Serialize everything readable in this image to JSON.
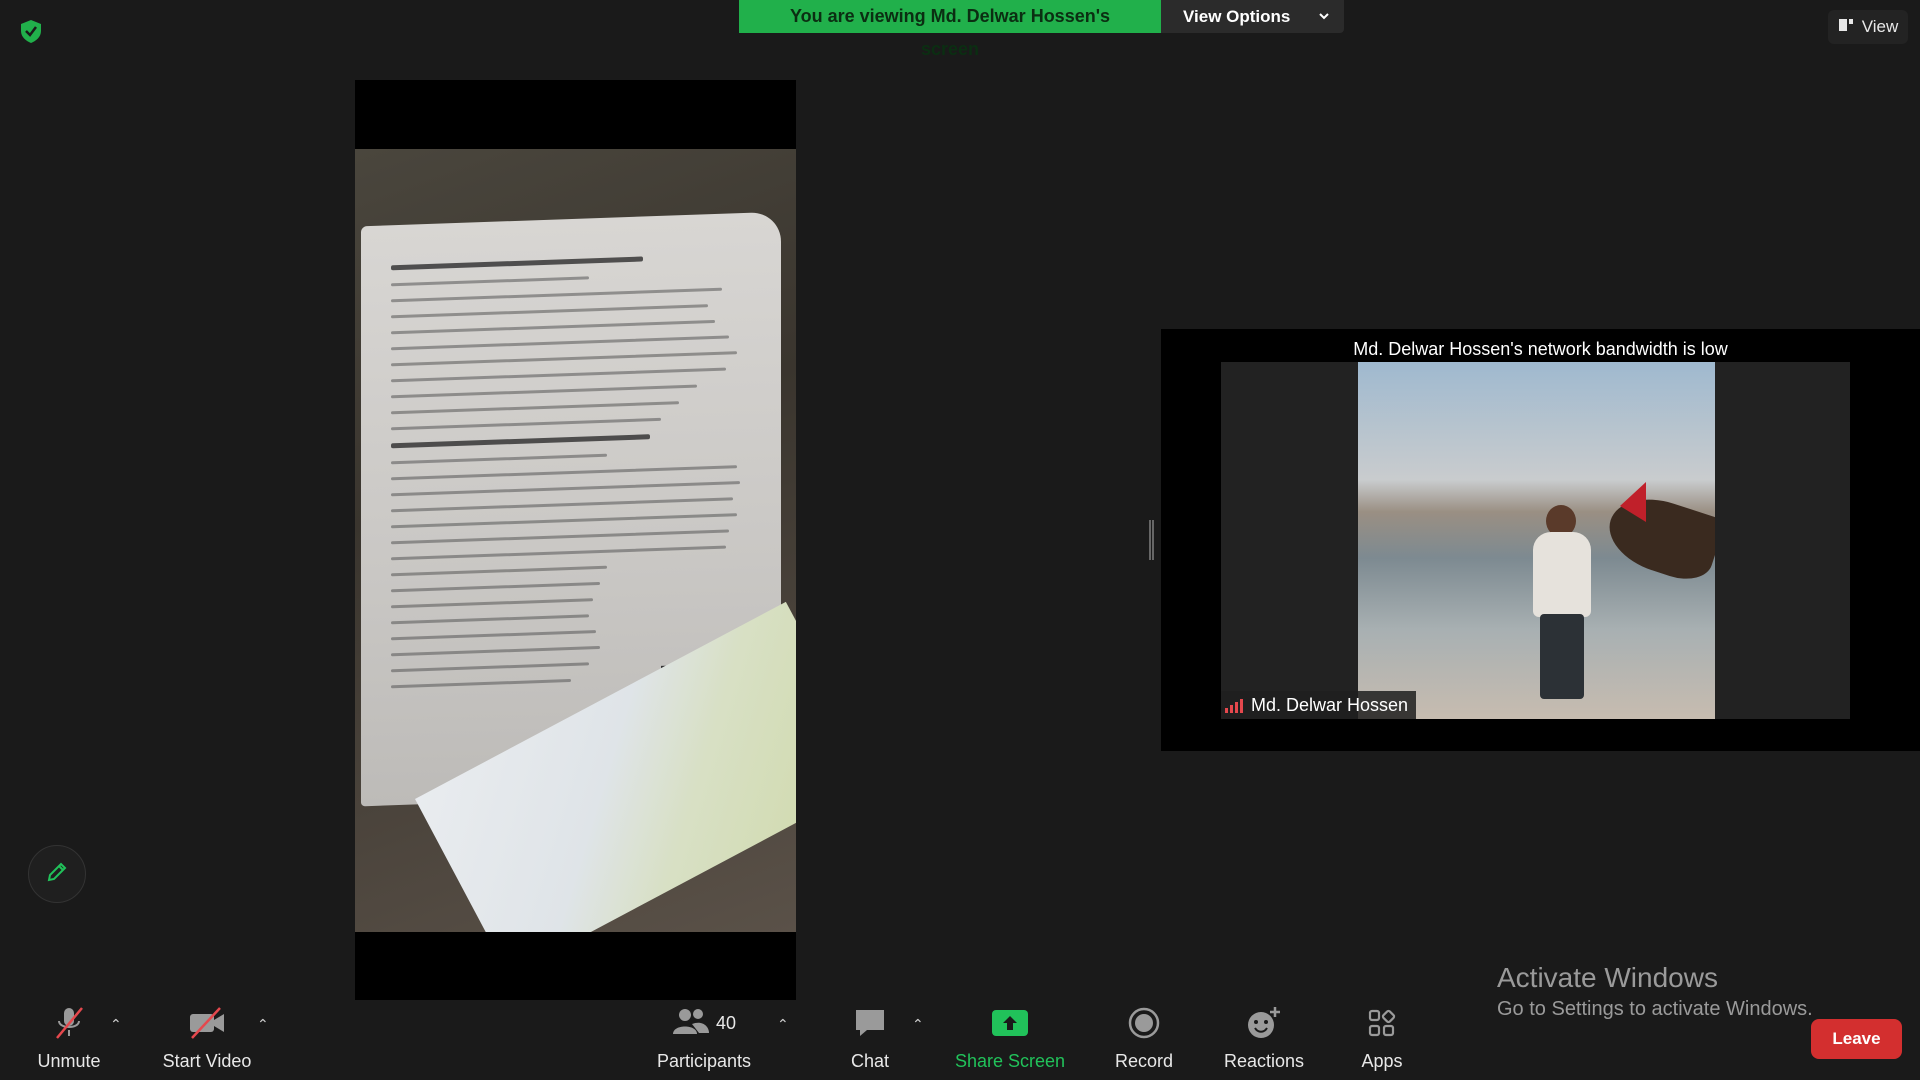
{
  "banner": {
    "viewing_text": "You are viewing Md. Delwar Hossen's screen",
    "view_options_label": "View Options"
  },
  "view_button": {
    "label": "View"
  },
  "video_tile": {
    "bandwidth_message": "Md. Delwar Hossen's network bandwidth is low",
    "participant_name": "Md. Delwar Hossen"
  },
  "activate_windows": {
    "title": "Activate Windows",
    "subtitle": "Go to Settings to activate Windows."
  },
  "toolbar": {
    "unmute_label": "Unmute",
    "start_video_label": "Start Video",
    "participants_label": "Participants",
    "participants_count": "40",
    "chat_label": "Chat",
    "share_screen_label": "Share Screen",
    "record_label": "Record",
    "reactions_label": "Reactions",
    "apps_label": "Apps",
    "leave_label": "Leave"
  },
  "colors": {
    "accent_green": "#21b04b",
    "leave_red": "#d32f2f",
    "signal_red": "#e5484d"
  },
  "icons": [
    "shield-check-icon",
    "chevron-down-icon",
    "view-icon",
    "pencil-icon",
    "mic-muted-icon",
    "video-off-icon",
    "participants-icon",
    "chat-icon",
    "share-screen-icon",
    "record-icon",
    "reactions-icon",
    "apps-icon",
    "signal-bars-icon"
  ]
}
